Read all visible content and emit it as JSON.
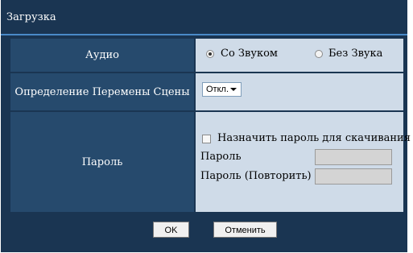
{
  "dialog": {
    "title": "Загрузка"
  },
  "audio": {
    "label": "Аудио",
    "options": [
      {
        "label": "Со Звуком",
        "selected": true
      },
      {
        "label": "Без Звука",
        "selected": false
      }
    ]
  },
  "scene_change": {
    "label": "Определение Перемены Сцены",
    "selected_value": "Откл."
  },
  "password": {
    "label": "Пароль",
    "assign_checkbox_label": "Назначить пароль для скачивания",
    "assign_checked": false,
    "password_label": "Пароль",
    "password_value": "",
    "repeat_label": "Пароль (Повторить)",
    "repeat_value": ""
  },
  "buttons": {
    "ok_label": "OK",
    "cancel_label": "Отменить"
  },
  "colors": {
    "background": "#1a3552",
    "header_cells": "#264a6d",
    "value_cells": "#cfdbe8",
    "title_rule": "#4a8ac8"
  }
}
